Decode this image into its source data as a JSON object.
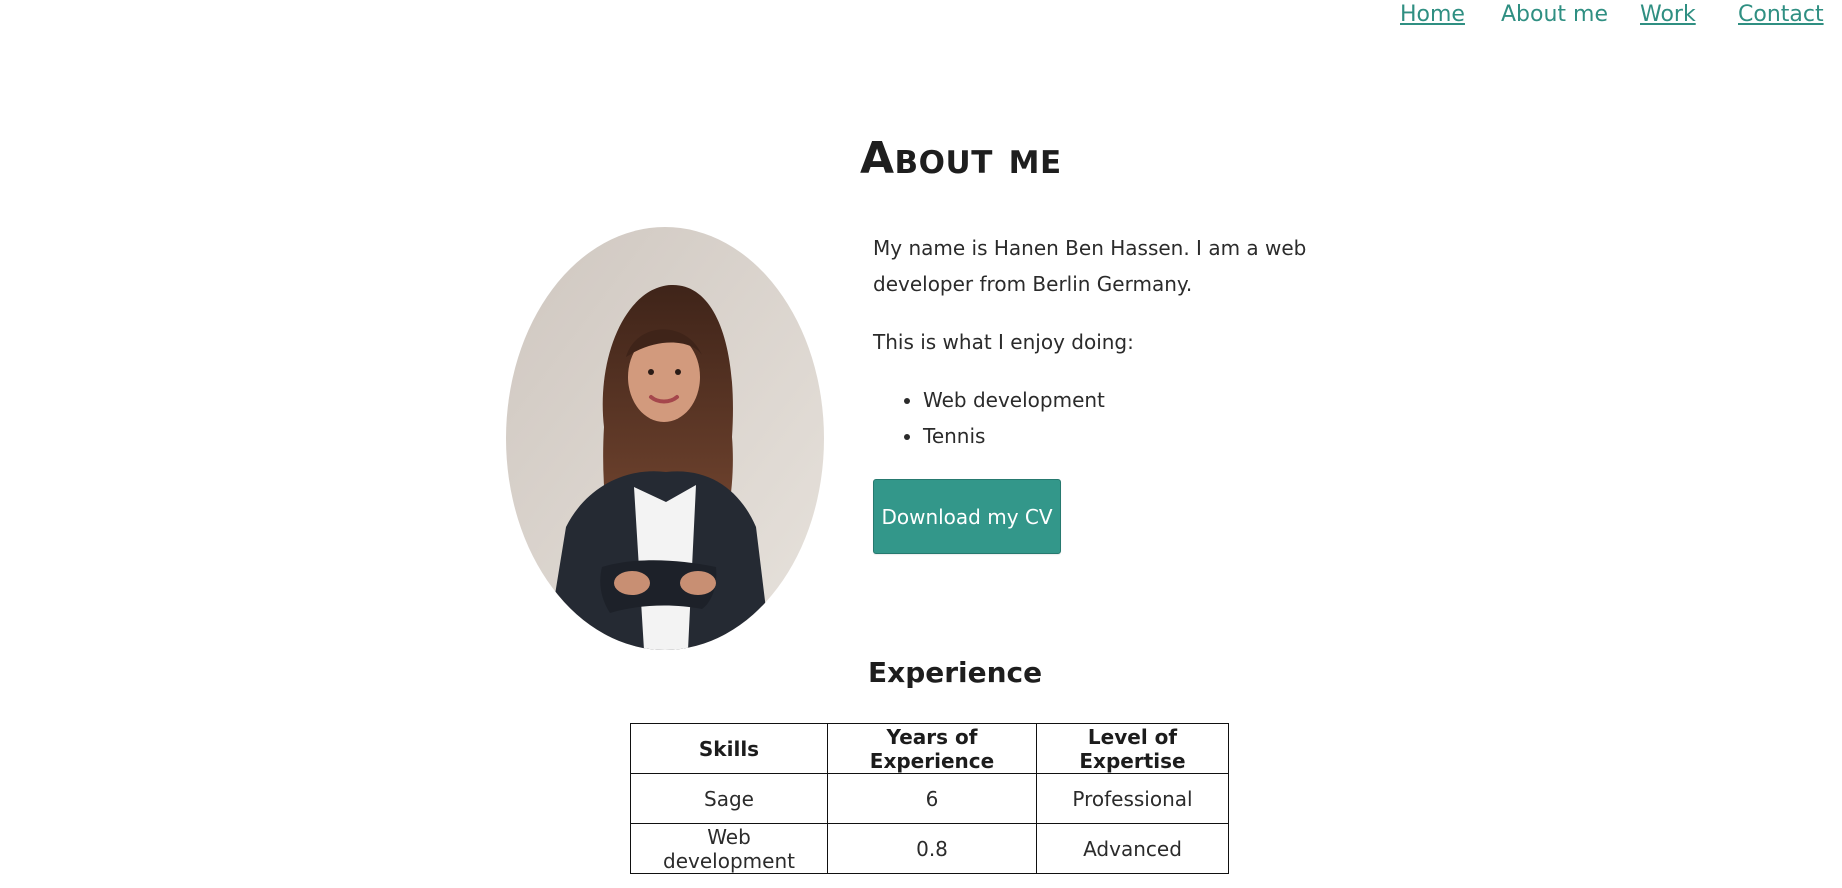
{
  "nav": {
    "items": [
      {
        "label": "Home",
        "active": false
      },
      {
        "label": "About me",
        "active": true
      },
      {
        "label": "Work",
        "active": false
      },
      {
        "label": "Contact",
        "active": false
      }
    ]
  },
  "about": {
    "title": "About me",
    "intro_1": "My name is Hanen Ben Hassen. I am a web developer from Berlin Germany.",
    "intro_2": "This is what I enjoy doing:",
    "hobbies": [
      "Web development",
      "Tennis"
    ],
    "cv_button": "Download my CV"
  },
  "experience": {
    "title": "Experience",
    "headers": [
      "Skills",
      "Years of Experience",
      "Level of Expertise"
    ],
    "rows": [
      [
        "Sage",
        "6",
        "Professional"
      ],
      [
        "Web development",
        "0.8",
        "Advanced"
      ]
    ]
  },
  "colors": {
    "accent": "#33978a",
    "link": "#2f8f82",
    "text": "#222222"
  }
}
